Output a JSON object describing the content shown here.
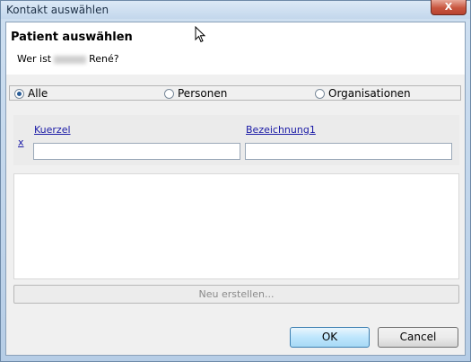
{
  "window": {
    "title": "Kontakt auswählen",
    "close_label": "X"
  },
  "header": {
    "title": "Patient auswählen",
    "question_prefix": "Wer ist",
    "question_suffix": "René?"
  },
  "filters": {
    "options": [
      {
        "label": "Alle",
        "selected": true
      },
      {
        "label": "Personen",
        "selected": false
      },
      {
        "label": "Organisationen",
        "selected": false
      }
    ]
  },
  "search": {
    "clear_label": "x",
    "columns": [
      {
        "label": "Kuerzel",
        "value": ""
      },
      {
        "label": "Bezeichnung1",
        "value": ""
      }
    ]
  },
  "actions": {
    "new_label": "Neu erstellen...",
    "ok_label": "OK",
    "cancel_label": "Cancel"
  }
}
